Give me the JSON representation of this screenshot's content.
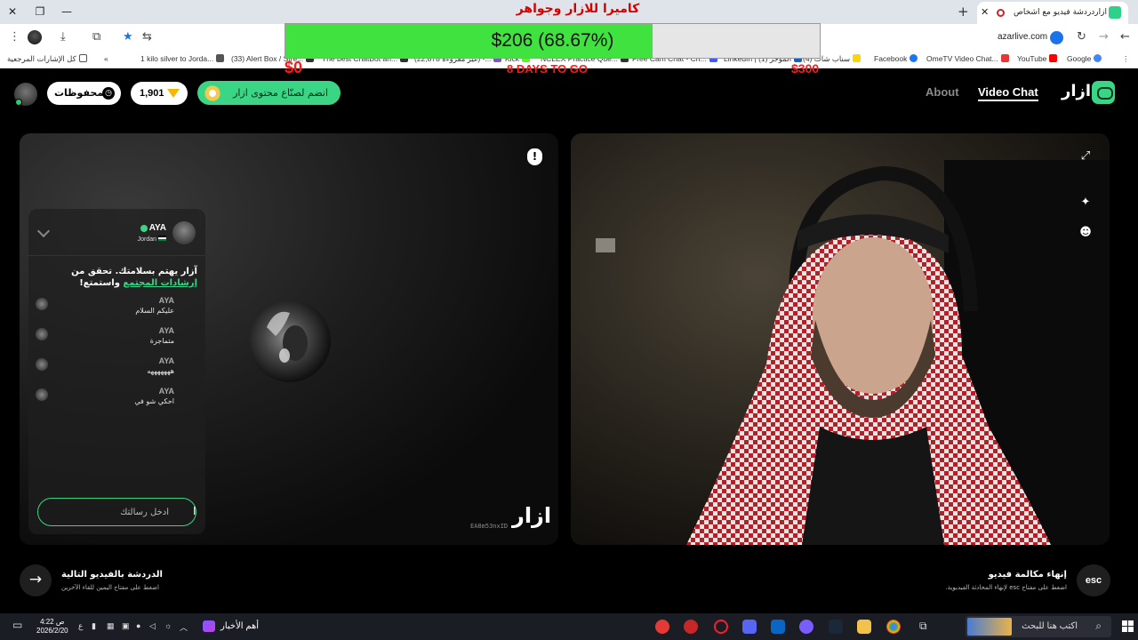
{
  "browser": {
    "tab_title": "أزار‏دردشة فيديو مع أشخاص",
    "url": "azarlive.com",
    "bookmarks": [
      {
        "label": "كل الإشارات المرجعية",
        "color": "#555555"
      },
      {
        "label": "1 kilo silver to Jorda...",
        "color": "#555555"
      },
      {
        "label": "(33) Alert Box / Stre...",
        "color": "#333333"
      },
      {
        "label": "The best ChatBot an...",
        "color": "#333333"
      },
      {
        "label": "(22,878 غير مقروءة) -...",
        "color": "#7e57c2"
      },
      {
        "label": "Kick",
        "color": "#53fc18"
      },
      {
        "label": "NCLEX Practice Que...",
        "color": "#333333"
      },
      {
        "label": "Free Cam Chat - Ch...",
        "color": "#3d5afe"
      },
      {
        "label": "LinkedIn | الموجز (1)",
        "color": "#0a66c2"
      },
      {
        "label": "(4) سناب شات",
        "color": "#f7d708"
      },
      {
        "label": "Facebook",
        "color": "#1877f2"
      },
      {
        "label": "OmeTV Video Chat...",
        "color": "#e53935"
      },
      {
        "label": "YouTube",
        "color": "#ff0000"
      },
      {
        "label": "Google",
        "color": "#4285f4"
      }
    ]
  },
  "overlay": {
    "title": "كاميرا للازار وجواهر",
    "goal_text": "$206 (68.67%)",
    "goal_progress": 0.6867,
    "start_label": "$0",
    "days_label": "8 DAYS TO GO",
    "end_label": "$300"
  },
  "header": {
    "saved_label": "المحفوظات",
    "gems_count": "1,901",
    "creator_label": "انضم لصنّاع محتوى ازار",
    "nav_about": "About",
    "nav_video_chat": "Video Chat",
    "brand": "ازار"
  },
  "chat": {
    "user_name": "AYA",
    "user_country": "Jordan",
    "notice_text": "آزار يهتم بسلامتك. تحقق من ",
    "notice_link": "إرشادات المجتمع",
    "notice_tail": " واستمتع!",
    "messages": [
      {
        "name": "AYA",
        "text": "عليكم السلام"
      },
      {
        "name": "AYA",
        "text": "متماجرة"
      },
      {
        "name": "AYA",
        "text": "هههههههه"
      },
      {
        "name": "AYA",
        "text": "احكي شو في"
      }
    ],
    "input_placeholder": "أدخل رسالتك"
  },
  "peer": {
    "watermark_id": "EA8m53nxID",
    "watermark_logo": "ازار"
  },
  "controls": {
    "next_title": "الدردشة بالفيديو التالية",
    "next_sub": "اضغط على مفتاح اليمين للقاء الآخرين",
    "end_title": "إنهاء مكالمة فيديو",
    "end_sub": "اضغط على مفتاح esc لإنهاء المحادثة الفيديوية.",
    "esc_label": "esc"
  },
  "taskbar": {
    "time": "4:22 ص",
    "date": "2026/2/20",
    "news_label": "أهم الأخبار",
    "search_placeholder": "اكتب هنا للبحث",
    "lang": "ع"
  },
  "colors": {
    "accent": "#3ad686",
    "goal_fill": "#3fe23f",
    "goal_red": "#ff1a1a"
  }
}
